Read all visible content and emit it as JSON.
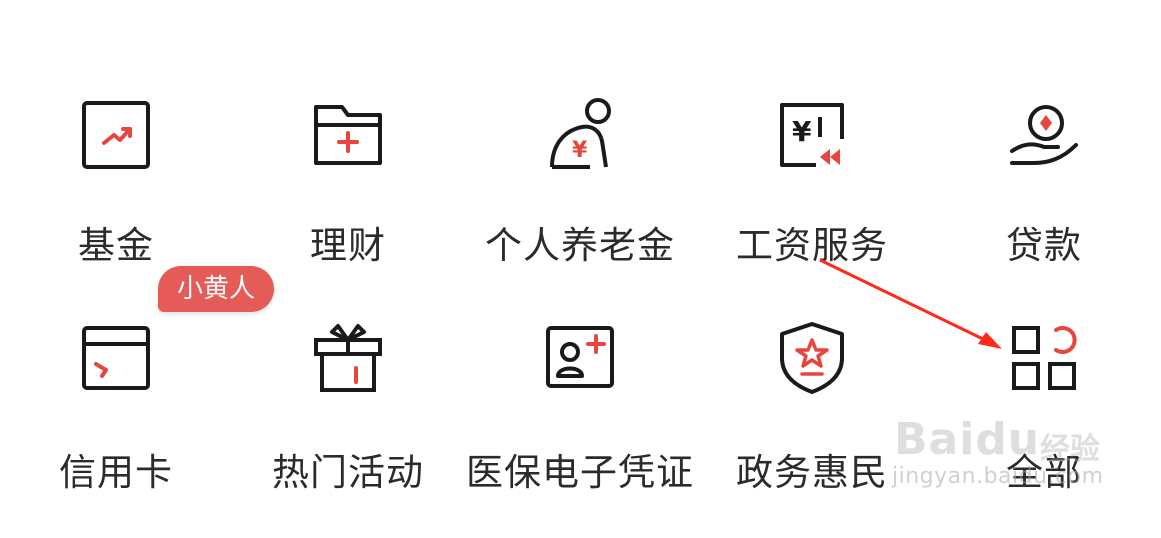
{
  "menu": {
    "row1": [
      {
        "label": "基金",
        "icon": "fund-chart-icon"
      },
      {
        "label": "理财",
        "icon": "folder-plus-icon"
      },
      {
        "label": "个人养老金",
        "icon": "elderly-yuan-icon"
      },
      {
        "label": "工资服务",
        "icon": "salary-card-icon"
      },
      {
        "label": "贷款",
        "icon": "hand-coin-icon"
      }
    ],
    "row2": [
      {
        "label": "信用卡",
        "icon": "credit-card-icon"
      },
      {
        "label": "热门活动",
        "icon": "gift-box-icon"
      },
      {
        "label": "医保电子凭证",
        "icon": "medical-id-card-icon"
      },
      {
        "label": "政务惠民",
        "icon": "shield-star-icon"
      },
      {
        "label": "全部",
        "icon": "all-apps-grid-icon"
      }
    ]
  },
  "badge": {
    "text": "小黄人"
  },
  "watermark": {
    "brand": "Baidu",
    "cn": "经验",
    "url": "jingyan.baidu.com"
  },
  "colors": {
    "accent": "#e8453c",
    "icon_stroke": "#1a1a1a",
    "badge_bg": "#e55b58",
    "text": "#2b2b2b"
  }
}
